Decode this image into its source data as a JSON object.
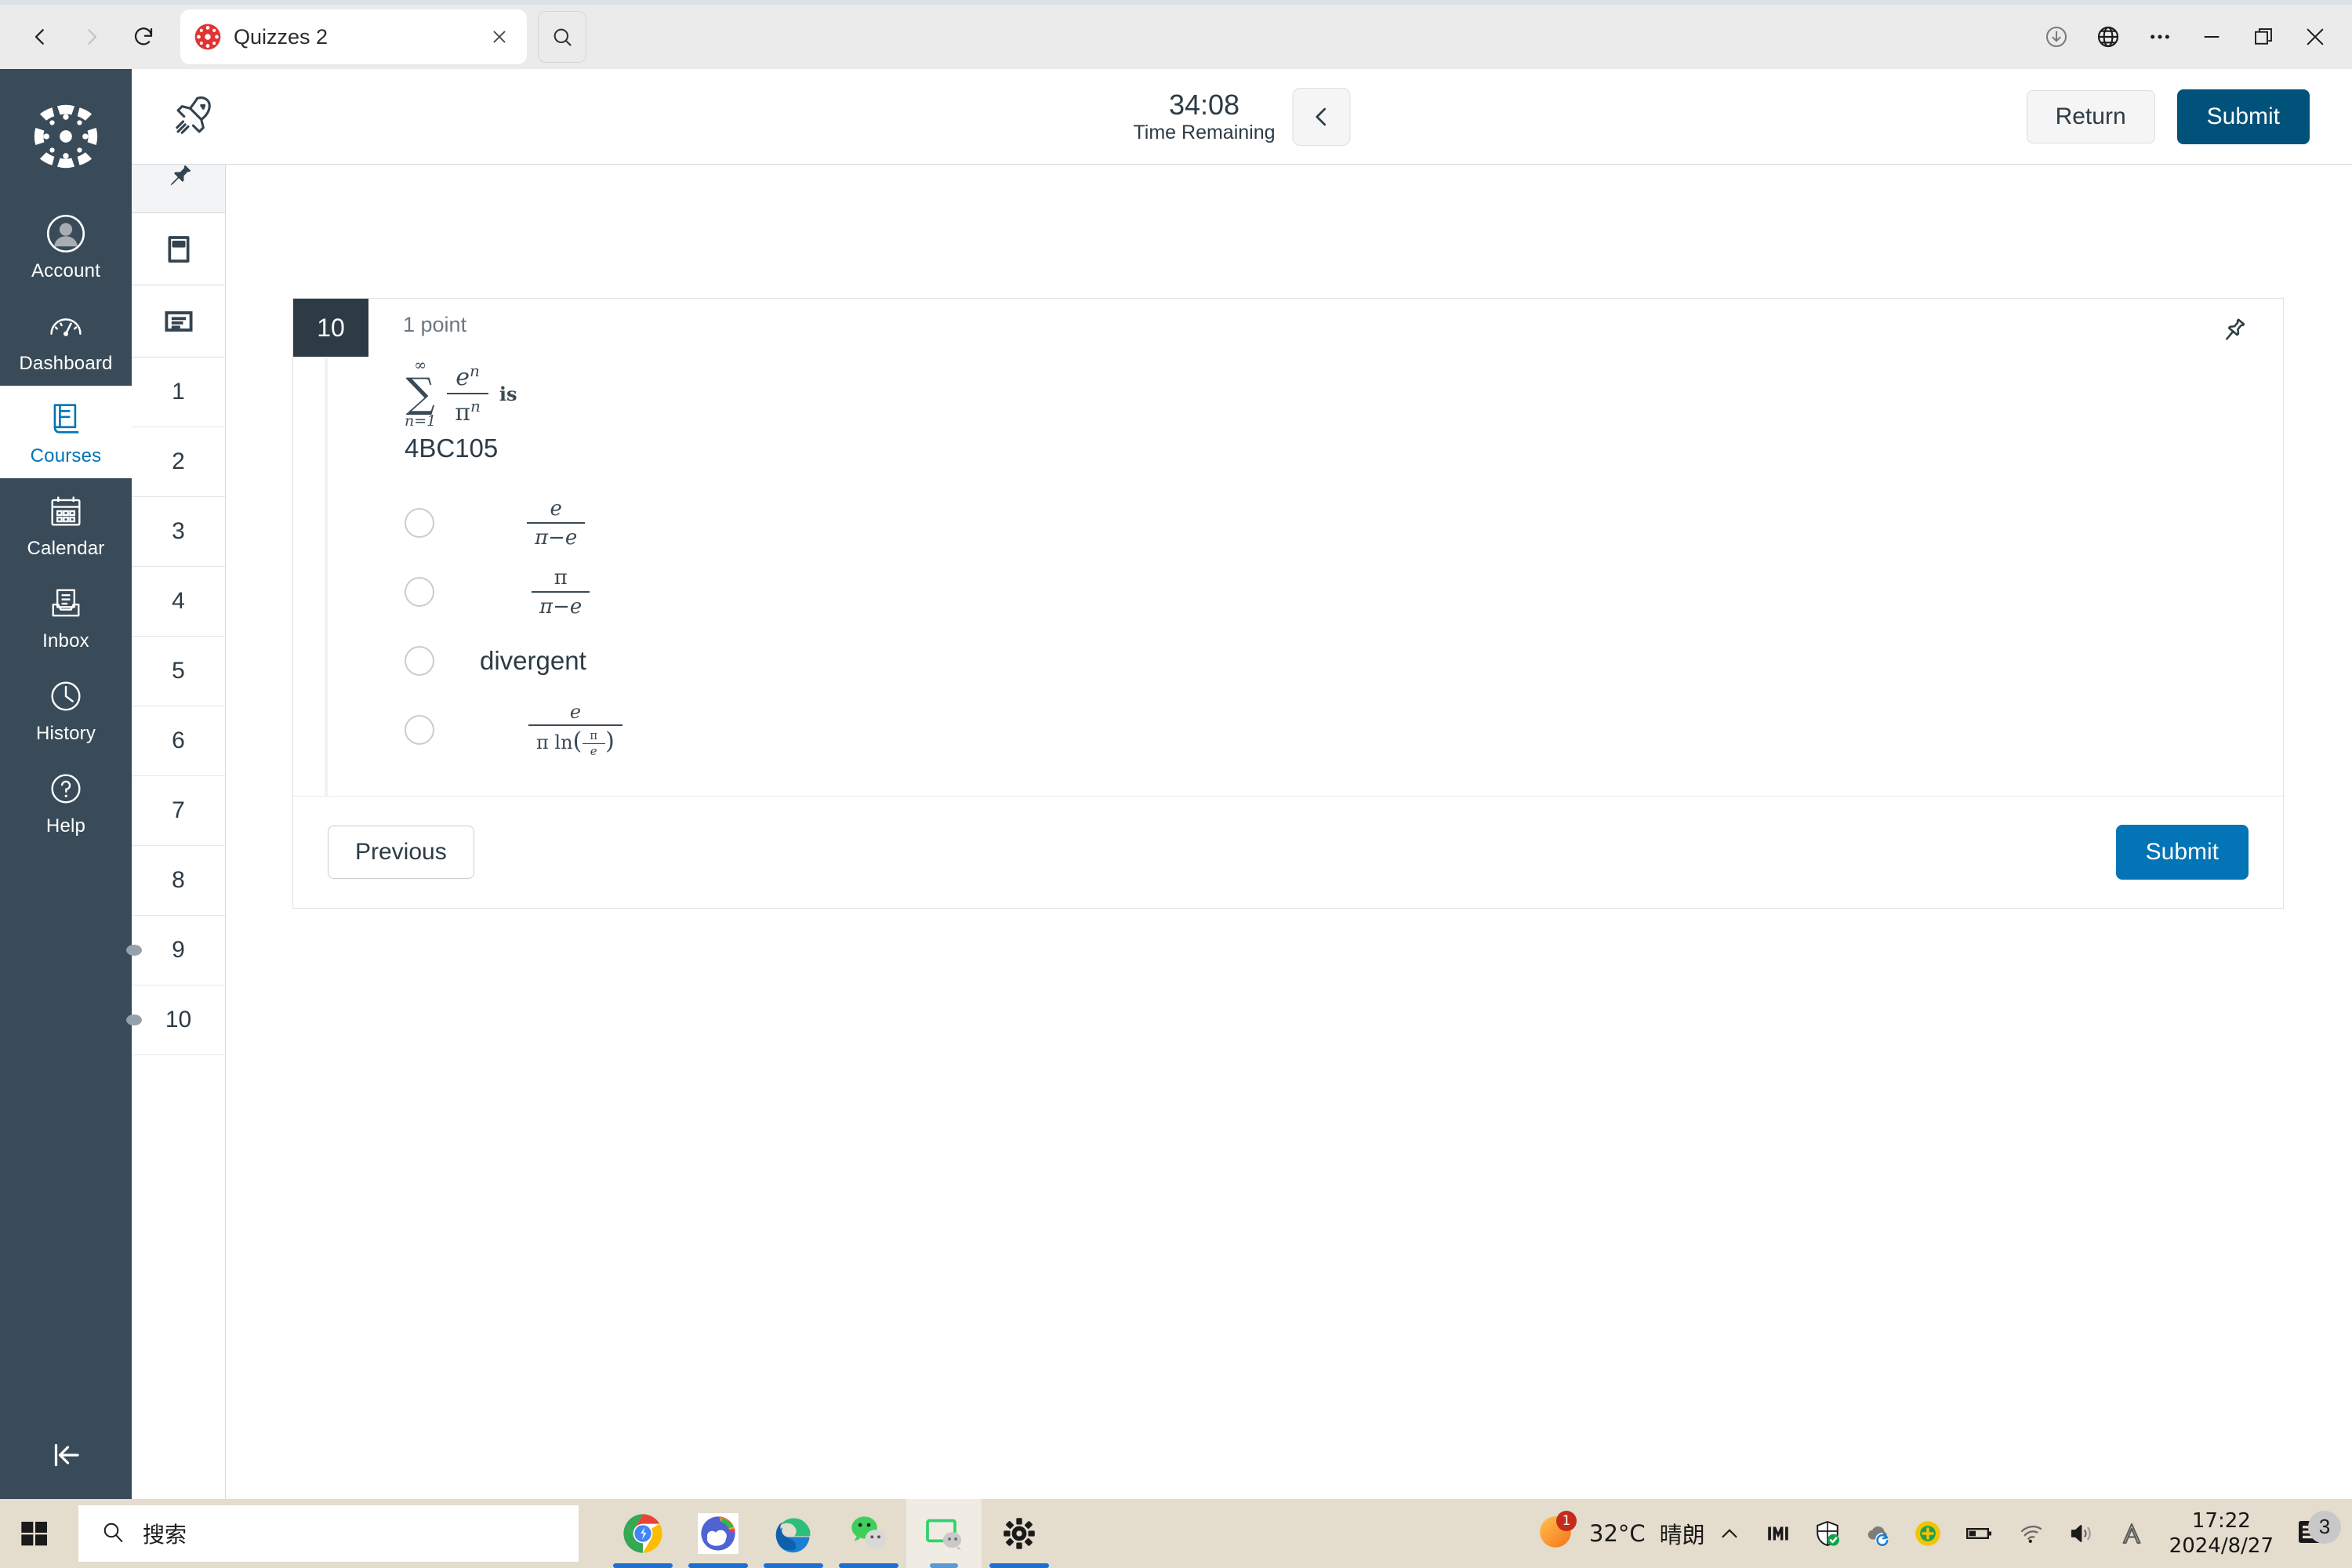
{
  "browser": {
    "tab_title": "Quizzes 2",
    "favicon": "canvas-logo-icon",
    "nav": {
      "back": "back-icon",
      "forward": "forward-icon",
      "reload": "reload-icon",
      "close_tab": "close-icon",
      "tab_search": "search-icon"
    },
    "window_controls": {
      "downloads": "download-icon",
      "translate": "globe-icon",
      "more": "more-options-icon",
      "minimize": "minimize-icon",
      "restore": "restore-icon",
      "close": "window-close-icon"
    }
  },
  "global_nav": {
    "logo": "canvas-logo",
    "items": [
      {
        "label": "Account",
        "icon": "avatar-icon",
        "active": false
      },
      {
        "label": "Dashboard",
        "icon": "speedometer-icon",
        "active": false
      },
      {
        "label": "Courses",
        "icon": "book-icon",
        "active": true
      },
      {
        "label": "Calendar",
        "icon": "calendar-icon",
        "active": false
      },
      {
        "label": "Inbox",
        "icon": "inbox-icon",
        "active": false
      },
      {
        "label": "History",
        "icon": "clock-icon",
        "active": false
      },
      {
        "label": "Help",
        "icon": "question-circle-icon",
        "active": false
      }
    ],
    "collapse_label": "collapse-nav-icon"
  },
  "quiz_rail": {
    "tools": [
      {
        "icon": "collapse-panel-icon",
        "selected": false
      },
      {
        "icon": "pin-icon",
        "selected": true
      },
      {
        "icon": "calculator-icon",
        "selected": false
      },
      {
        "icon": "notes-icon",
        "selected": false
      }
    ],
    "questions": [
      {
        "number": "1",
        "flag": false
      },
      {
        "number": "2",
        "flag": false
      },
      {
        "number": "3",
        "flag": false
      },
      {
        "number": "4",
        "flag": false
      },
      {
        "number": "5",
        "flag": false
      },
      {
        "number": "6",
        "flag": false
      },
      {
        "number": "7",
        "flag": false
      },
      {
        "number": "8",
        "flag": false
      },
      {
        "number": "9",
        "flag": true
      },
      {
        "number": "10",
        "flag": true
      }
    ]
  },
  "topbar": {
    "rocket_icon": "rocket-icon",
    "time_value": "34:08",
    "time_label": "Time Remaining",
    "collapse_icon": "chevron-left-icon",
    "return_label": "Return",
    "submit_label": "Submit"
  },
  "question": {
    "number": "10",
    "points": "1 point",
    "pin_icon": "pin-outline-icon",
    "stem": {
      "sum_upper": "∞",
      "sum_symbol": "∑",
      "sum_lower": "n=1",
      "numerator": "e",
      "numerator_exp": "n",
      "denominator": "π",
      "denominator_exp": "n",
      "trailing_word": "is"
    },
    "code": "4BC105",
    "answers": [
      {
        "type": "fraction",
        "num": "e",
        "den": "π−e",
        "text": ""
      },
      {
        "type": "fraction",
        "num": "π",
        "den": "π−e",
        "text": ""
      },
      {
        "type": "text",
        "num": "",
        "den": "",
        "text": "divergent"
      },
      {
        "type": "fraction-log",
        "num": "e",
        "den": "π ln(π/e)",
        "text": ""
      }
    ],
    "previous_label": "Previous",
    "submit_label": "Submit"
  },
  "taskbar": {
    "start_icon": "windows-start-icon",
    "search_placeholder": "搜索",
    "search_icon": "search-icon",
    "apps": [
      {
        "name": "google-chrome",
        "active": false
      },
      {
        "name": "weather-app",
        "active": false
      },
      {
        "name": "microsoft-edge",
        "active": false
      },
      {
        "name": "wechat",
        "active": false
      },
      {
        "name": "wechat-window",
        "active": true
      },
      {
        "name": "settings-gear",
        "active": false
      }
    ],
    "weather_temp": "32°C",
    "weather_desc": "晴朗",
    "weather_badge": "1",
    "tray_icons": [
      "chevron-up-icon",
      "ime-icon",
      "security-shield-icon",
      "onedrive-sync-icon",
      "plus-circle-icon",
      "battery-icon",
      "wifi-icon",
      "volume-icon",
      "ime-letter-icon"
    ],
    "clock_time": "17:22",
    "clock_date": "2024/8/27",
    "notification_count": "3"
  },
  "colors": {
    "canvas_nav_bg": "#394B58",
    "active_blue": "#0374B5",
    "submit_dark": "#00527A",
    "question_badge": "#2D3B45",
    "taskbar_bg": "#e4dccc"
  }
}
